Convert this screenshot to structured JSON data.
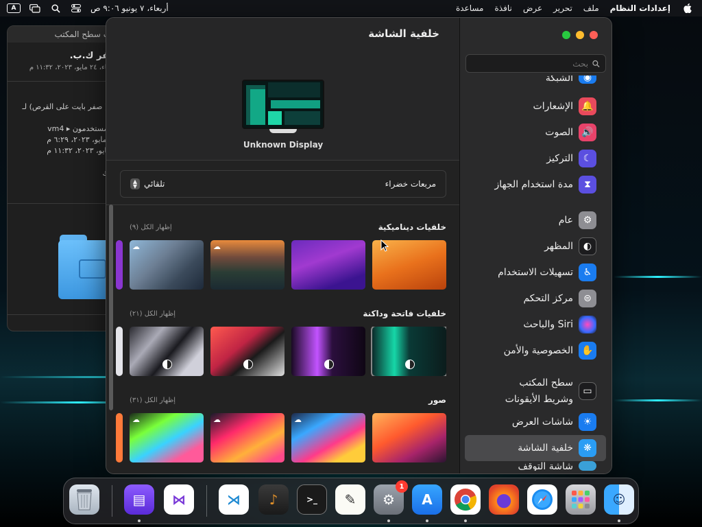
{
  "menubar": {
    "apple_icon": "apple-icon",
    "app_name": "إعدادات النظام",
    "menus": [
      "ملف",
      "تحرير",
      "عرض",
      "نافذة",
      "مساعدة"
    ],
    "clock": "أربعاء، ٧ يونيو  ٩:٠٦ ص",
    "input_source": "A",
    "status_icons": [
      "control-center-icon",
      "spotlight-icon",
      "screen-mirroring-icon",
      "input-source-icon"
    ]
  },
  "finder": {
    "title": "بات سطح المكتب",
    "name": "صفر ك.ب.",
    "date": "أربعاء، ٢٤ مايو، ٢٠٢٣، ١١:٣٢ م",
    "lines": [
      "ت ( صفر بايت على القرص) لـ",
      "صر",
      "ـ المستخدمون ▸ vm4",
      "١١ مايو، ٢٠٢٣، ٦:٢٩ م",
      "٢ مايو، ٢٠٢٣، ١١:٣٢ م",
      "ـترك"
    ]
  },
  "settings": {
    "search_placeholder": "بحث",
    "sidebar_partial_top": "الشبكة",
    "sidebar_items": [
      {
        "label": "الإشعارات",
        "icon": "notifications-icon",
        "color": "#e94a5c"
      },
      {
        "label": "الصوت",
        "icon": "sound-icon",
        "color": "#e8436a"
      },
      {
        "label": "التركيز",
        "icon": "focus-moon-icon",
        "color": "#5b4fe0"
      },
      {
        "label": "مدة استخدام الجهاز",
        "icon": "hourglass-icon",
        "color": "#5b4fe0"
      },
      {
        "label": "عام",
        "icon": "gear-icon",
        "color": "#8e8e93"
      },
      {
        "label": "المظهر",
        "icon": "appearance-icon",
        "color": "#1c1c1e"
      },
      {
        "label": "تسهيلات الاستخدام",
        "icon": "accessibility-icon",
        "color": "#1a7cf0"
      },
      {
        "label": "مركز التحكم",
        "icon": "control-center-icon",
        "color": "#8e8e93"
      },
      {
        "label": "Siri والباحث",
        "icon": "siri-icon",
        "color": "#2a2a2e"
      },
      {
        "label": "الخصوصية والأمن",
        "icon": "privacy-hand-icon",
        "color": "#1a7cf0"
      },
      {
        "label": "سطح المكتب وشريط الأيقونات",
        "icon": "dock-icon",
        "color": "#1c1c1e"
      },
      {
        "label": "شاشات العرض",
        "icon": "brightness-icon",
        "color": "#1a7cf0"
      },
      {
        "label": "خلفية الشاشة",
        "icon": "wallpaper-icon",
        "color": "#2a9df4"
      }
    ],
    "sidebar_partial_bottom": "شاشة التوقف",
    "main_title": "خلفية الشاشة",
    "display_name": "Unknown Display",
    "wallpaper_name": "مربعات خضراء",
    "wallpaper_mode": "تلقائي",
    "sections": [
      {
        "title": "خلفيات ديناميكية",
        "show_all": "إظهار الكل (٩)"
      },
      {
        "title": "خلفيات فاتحة وداكنة",
        "show_all": "إظهار الكل (٢١)"
      },
      {
        "title": "صور",
        "show_all": "إظهار الكل (٣١)"
      }
    ]
  },
  "dock": {
    "apps": [
      {
        "name": "finder",
        "label": "Finder"
      },
      {
        "name": "launchpad",
        "label": "Launchpad"
      },
      {
        "name": "safari",
        "label": "Safari"
      },
      {
        "name": "firefox",
        "label": "Firefox"
      },
      {
        "name": "chrome",
        "label": "Chrome"
      },
      {
        "name": "app-store",
        "label": "App Store"
      },
      {
        "name": "system-settings",
        "label": "System Settings",
        "badge": "1"
      },
      {
        "name": "textedit",
        "label": "TextEdit"
      },
      {
        "name": "terminal",
        "label": "Terminal"
      },
      {
        "name": "garageband",
        "label": "GarageBand"
      },
      {
        "name": "vscode",
        "label": "Visual Studio Code"
      },
      {
        "name": "visual-studio",
        "label": "Visual Studio"
      },
      {
        "name": "simulator",
        "label": "Simulator"
      },
      {
        "name": "trash",
        "label": "Trash"
      }
    ]
  }
}
